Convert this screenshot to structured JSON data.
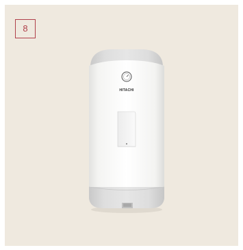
{
  "badge": {
    "text": "8",
    "color": "#b0404a"
  },
  "product": {
    "brand": "HITACHI",
    "type": "white cylindrical hot water tank",
    "body_color": "#f6f6f4",
    "cap_color": "#dcdcdc"
  },
  "colors": {
    "background": "#efe9df",
    "accent": "#b0404a"
  }
}
